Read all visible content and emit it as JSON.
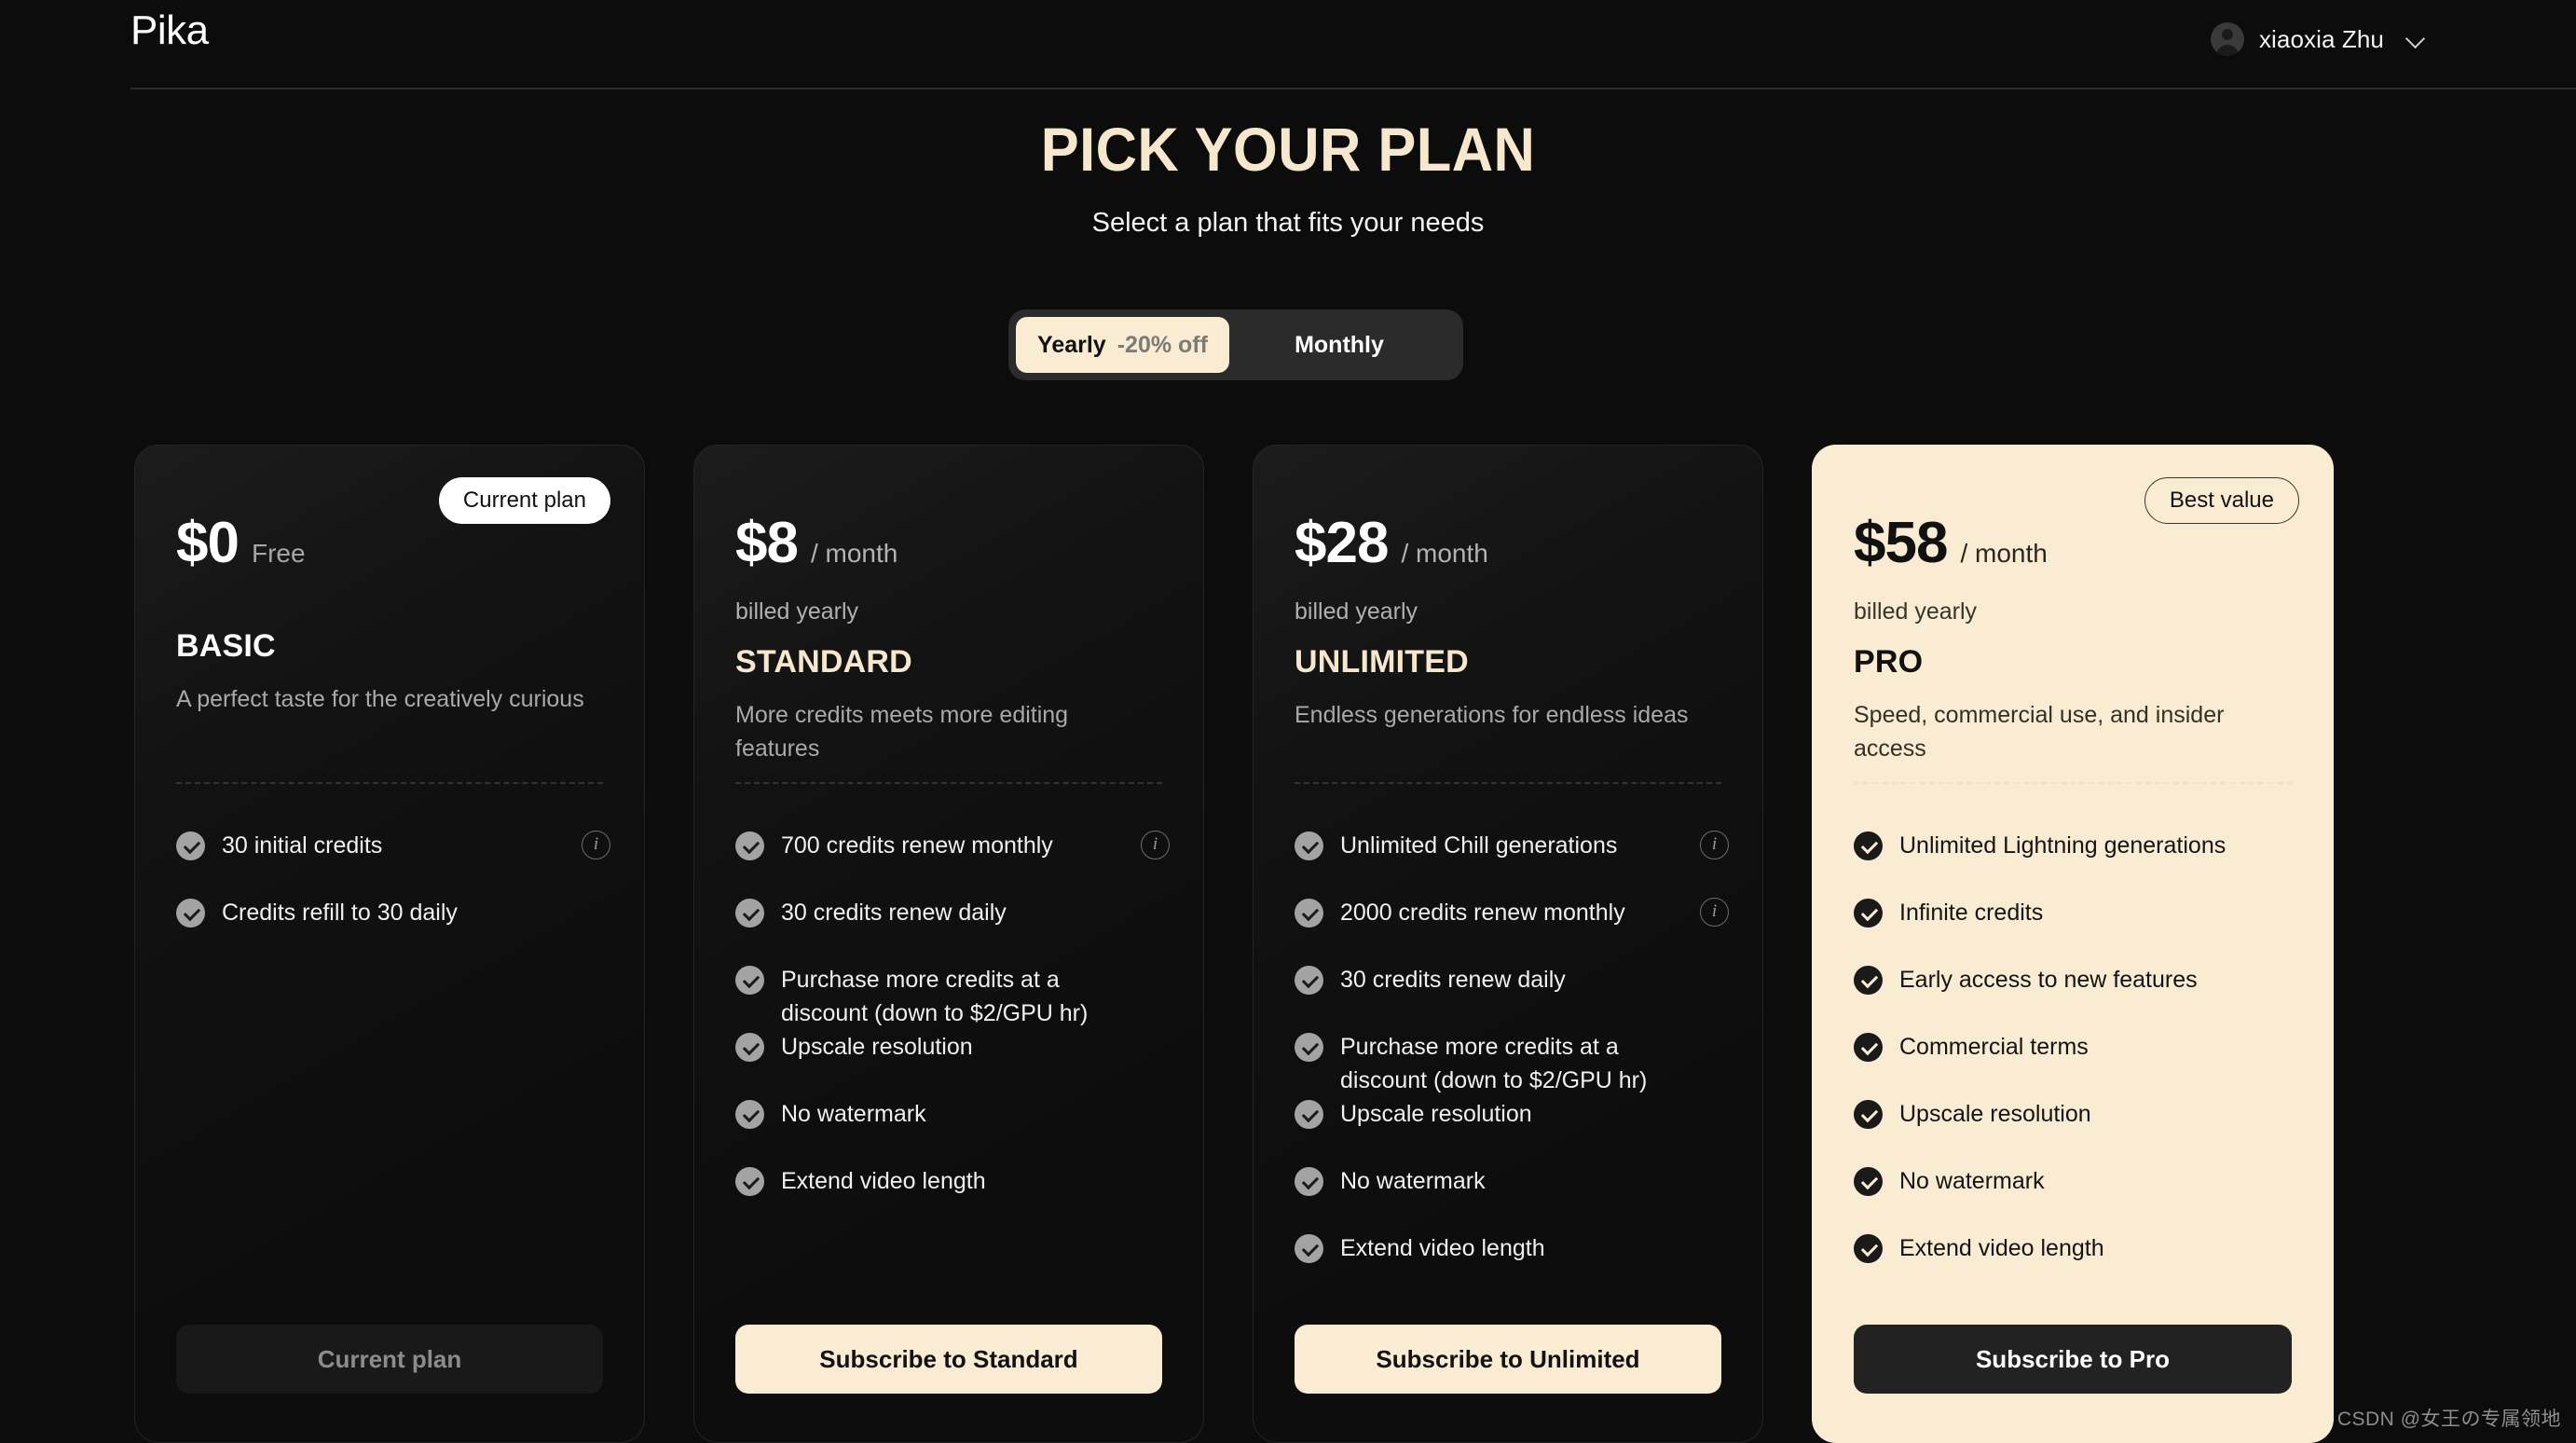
{
  "header": {
    "logo": "Pika",
    "account_name": "xiaoxia Zhu",
    "avatar_icon": "user-avatar-icon",
    "chevron_icon": "chevron-down-icon"
  },
  "page": {
    "title": "PICK YOUR PLAN",
    "subtitle": "Select a plan that fits your needs"
  },
  "billing_toggle": {
    "yearly_label": "Yearly",
    "yearly_discount": "-20% off",
    "monthly_label": "Monthly",
    "selected": "Yearly",
    "active_bg": "#faecd3",
    "track_bg": "#2b2b2b"
  },
  "plans": [
    {
      "price": "$0",
      "price_unit": "Free",
      "billed": "",
      "name": "BASIC",
      "description": "A perfect taste for the creatively curious",
      "badge": "Current plan",
      "features": [
        {
          "text": "30 initial credits",
          "info": true
        },
        {
          "text": "Credits refill to 30 daily",
          "info": false
        }
      ],
      "cta": "Current plan"
    },
    {
      "price": "$8",
      "price_unit": "/ month",
      "billed": "billed yearly",
      "name": "STANDARD",
      "description": "More credits meets more editing features",
      "badge": "",
      "features": [
        {
          "text": "700 credits renew monthly",
          "info": true
        },
        {
          "text": "30 credits renew daily",
          "info": false
        },
        {
          "text": "Purchase more credits at a discount (down to $2/GPU hr)",
          "info": false
        },
        {
          "text": "Upscale resolution",
          "info": false
        },
        {
          "text": "No watermark",
          "info": false
        },
        {
          "text": "Extend video length",
          "info": false
        }
      ],
      "cta": "Subscribe to Standard"
    },
    {
      "price": "$28",
      "price_unit": "/ month",
      "billed": "billed yearly",
      "name": "UNLIMITED",
      "description": "Endless generations for endless ideas",
      "badge": "",
      "features": [
        {
          "text": "Unlimited Chill generations",
          "info": true
        },
        {
          "text": "2000 credits renew monthly",
          "info": true
        },
        {
          "text": "30 credits renew daily",
          "info": false
        },
        {
          "text": "Purchase more credits at a discount (down to $2/GPU hr)",
          "info": false
        },
        {
          "text": "Upscale resolution",
          "info": false
        },
        {
          "text": "No watermark",
          "info": false
        },
        {
          "text": "Extend video length",
          "info": false
        }
      ],
      "cta": "Subscribe to Unlimited"
    },
    {
      "price": "$58",
      "price_unit": "/ month",
      "billed": "billed yearly",
      "name": "PRO",
      "description": "Speed, commercial use, and insider access",
      "badge": "Best value",
      "features": [
        {
          "text": "Unlimited Lightning generations",
          "info": false
        },
        {
          "text": "Infinite credits",
          "info": false
        },
        {
          "text": "Early access to new features",
          "info": false
        },
        {
          "text": "Commercial terms",
          "info": false
        },
        {
          "text": "Upscale resolution",
          "info": false
        },
        {
          "text": "No watermark",
          "info": false
        },
        {
          "text": "Extend video length",
          "info": false
        }
      ],
      "cta": "Subscribe to Pro"
    }
  ],
  "watermark": "CSDN @女王の专属领地",
  "colors": {
    "background": "#0c0c0c",
    "cream": "#faecd3",
    "card_dark": "#141414",
    "muted_text": "#a9a9a9"
  }
}
